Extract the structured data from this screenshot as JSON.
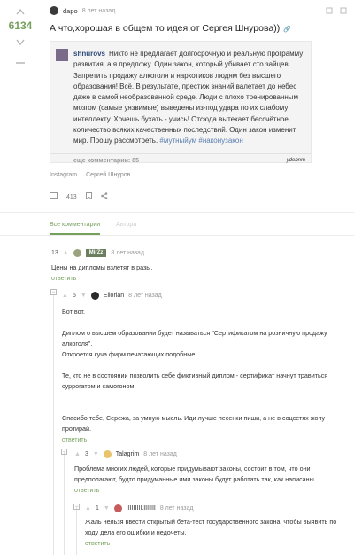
{
  "post": {
    "rating": "6134",
    "author": "dapo",
    "time": "8 лет назад",
    "title": "А что,хорошая в общем то идея,от Сергея Шнурова))",
    "embed": {
      "user": "shnurovs",
      "text_before": "Никто не предлагает долгосрочную и реальную программу развития, а я предложу. Один закон, который убивает сто зайцев. Запретить продажу алкоголя и наркотиков людям без высшего образования! Всё. В результате, престиж знаний валетает до небес даже в самой необразованной среде. Люди с плохо тренированным мозгом (самые уязвимые) выведены из-под удара по их слабому интеллекту. Хочешь бухать - учись! Отсюда вытекает бессчётное количество всяких качественных последствий. Один закон изменит мир. Прошу рассмотреть. ",
      "tag1": "#мутныйум",
      "tag2": "#наконузакон",
      "more": "еще комментарии: 85",
      "brand": "ydobnm"
    },
    "tags": [
      "Instagram",
      "Сергей Шнуров"
    ],
    "comments_count": "413"
  },
  "tabs": {
    "active": "Все комментарии",
    "other": "Автора"
  },
  "comments": [
    {
      "score": "13",
      "author": "MirZz",
      "time": "8 лет назад",
      "body": "Цены на дипломы взлетят в разы.",
      "reply": "ответить"
    },
    {
      "score": "5",
      "author": "Ellorian",
      "time": "8 лет назад",
      "p1": "Вот вот.",
      "p2": "Диплом о высшем образовании будет называться \"Сертификатом на розничную продажу алкоголя\".",
      "p3": "Откроется куча фирм печатающих подобные.",
      "p4": "Те, кто не в состоянии позволить себе фиктивный диплом - сертификат начнут травиться суррогатом и самогоном.",
      "p5": "Спасибо тебе, Сережа, за умную мысль. Иди лучше песенки пиши, а не в соцсетях жопу протирай.",
      "reply": "ответить"
    },
    {
      "score": "3",
      "author": "Talagrim",
      "time": "8 лет назад",
      "body": "Проблема многих людей, которые придумывают законы, состоит в том, что они предполагают, будто придуманные ими законы будут работать так, как написаны.",
      "reply": "ответить"
    },
    {
      "score": "1",
      "author": "IIIIIIIII.IIIIIII",
      "time": "8 лет назад",
      "body": "Жаль нельзя ввести открытый бета-тест государственного закона, чтобы выявить по ходу дела его ошибки и недочеты.",
      "reply": "ответить"
    }
  ],
  "colors": {
    "accent": "#76a15c",
    "link": "#5a7fb0"
  }
}
